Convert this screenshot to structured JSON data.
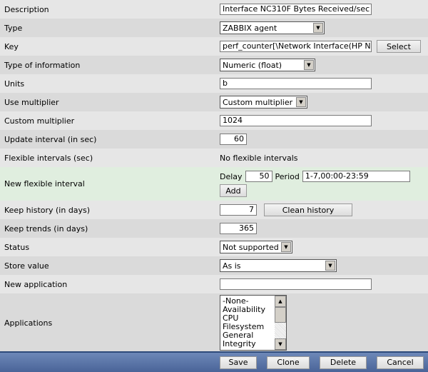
{
  "fields": {
    "description": {
      "label": "Description",
      "value": "Interface NC310F Bytes Received/sec"
    },
    "type": {
      "label": "Type",
      "value": "ZABBIX agent"
    },
    "key": {
      "label": "Key",
      "value": "perf_counter[\\Network Interface(HP NC",
      "button": "Select"
    },
    "type_info": {
      "label": "Type of information",
      "value": "Numeric (float)"
    },
    "units": {
      "label": "Units",
      "value": "b"
    },
    "use_multiplier": {
      "label": "Use multiplier",
      "value": "Custom multiplier"
    },
    "custom_multiplier": {
      "label": "Custom multiplier",
      "value": "1024"
    },
    "update_interval": {
      "label": "Update interval (in sec)",
      "value": "60"
    },
    "flexible_intervals": {
      "label": "Flexible intervals (sec)",
      "value": "No flexible intervals"
    },
    "new_flexible": {
      "label": "New flexible interval",
      "delay_label": "Delay",
      "delay": "50",
      "period_label": "Period",
      "period": "1-7,00:00-23:59",
      "add": "Add"
    },
    "keep_history": {
      "label": "Keep history (in days)",
      "value": "7",
      "button": "Clean history"
    },
    "keep_trends": {
      "label": "Keep trends (in days)",
      "value": "365"
    },
    "status": {
      "label": "Status",
      "value": "Not supported"
    },
    "store_value": {
      "label": "Store value",
      "value": "As is"
    },
    "new_application": {
      "label": "New application",
      "value": ""
    },
    "applications": {
      "label": "Applications",
      "options": [
        "-None-",
        "Availability",
        "CPU",
        "Filesystem",
        "General",
        "Integrity"
      ]
    }
  },
  "footer": {
    "save": "Save",
    "clone": "Clone",
    "delete": "Delete",
    "cancel": "Cancel"
  }
}
